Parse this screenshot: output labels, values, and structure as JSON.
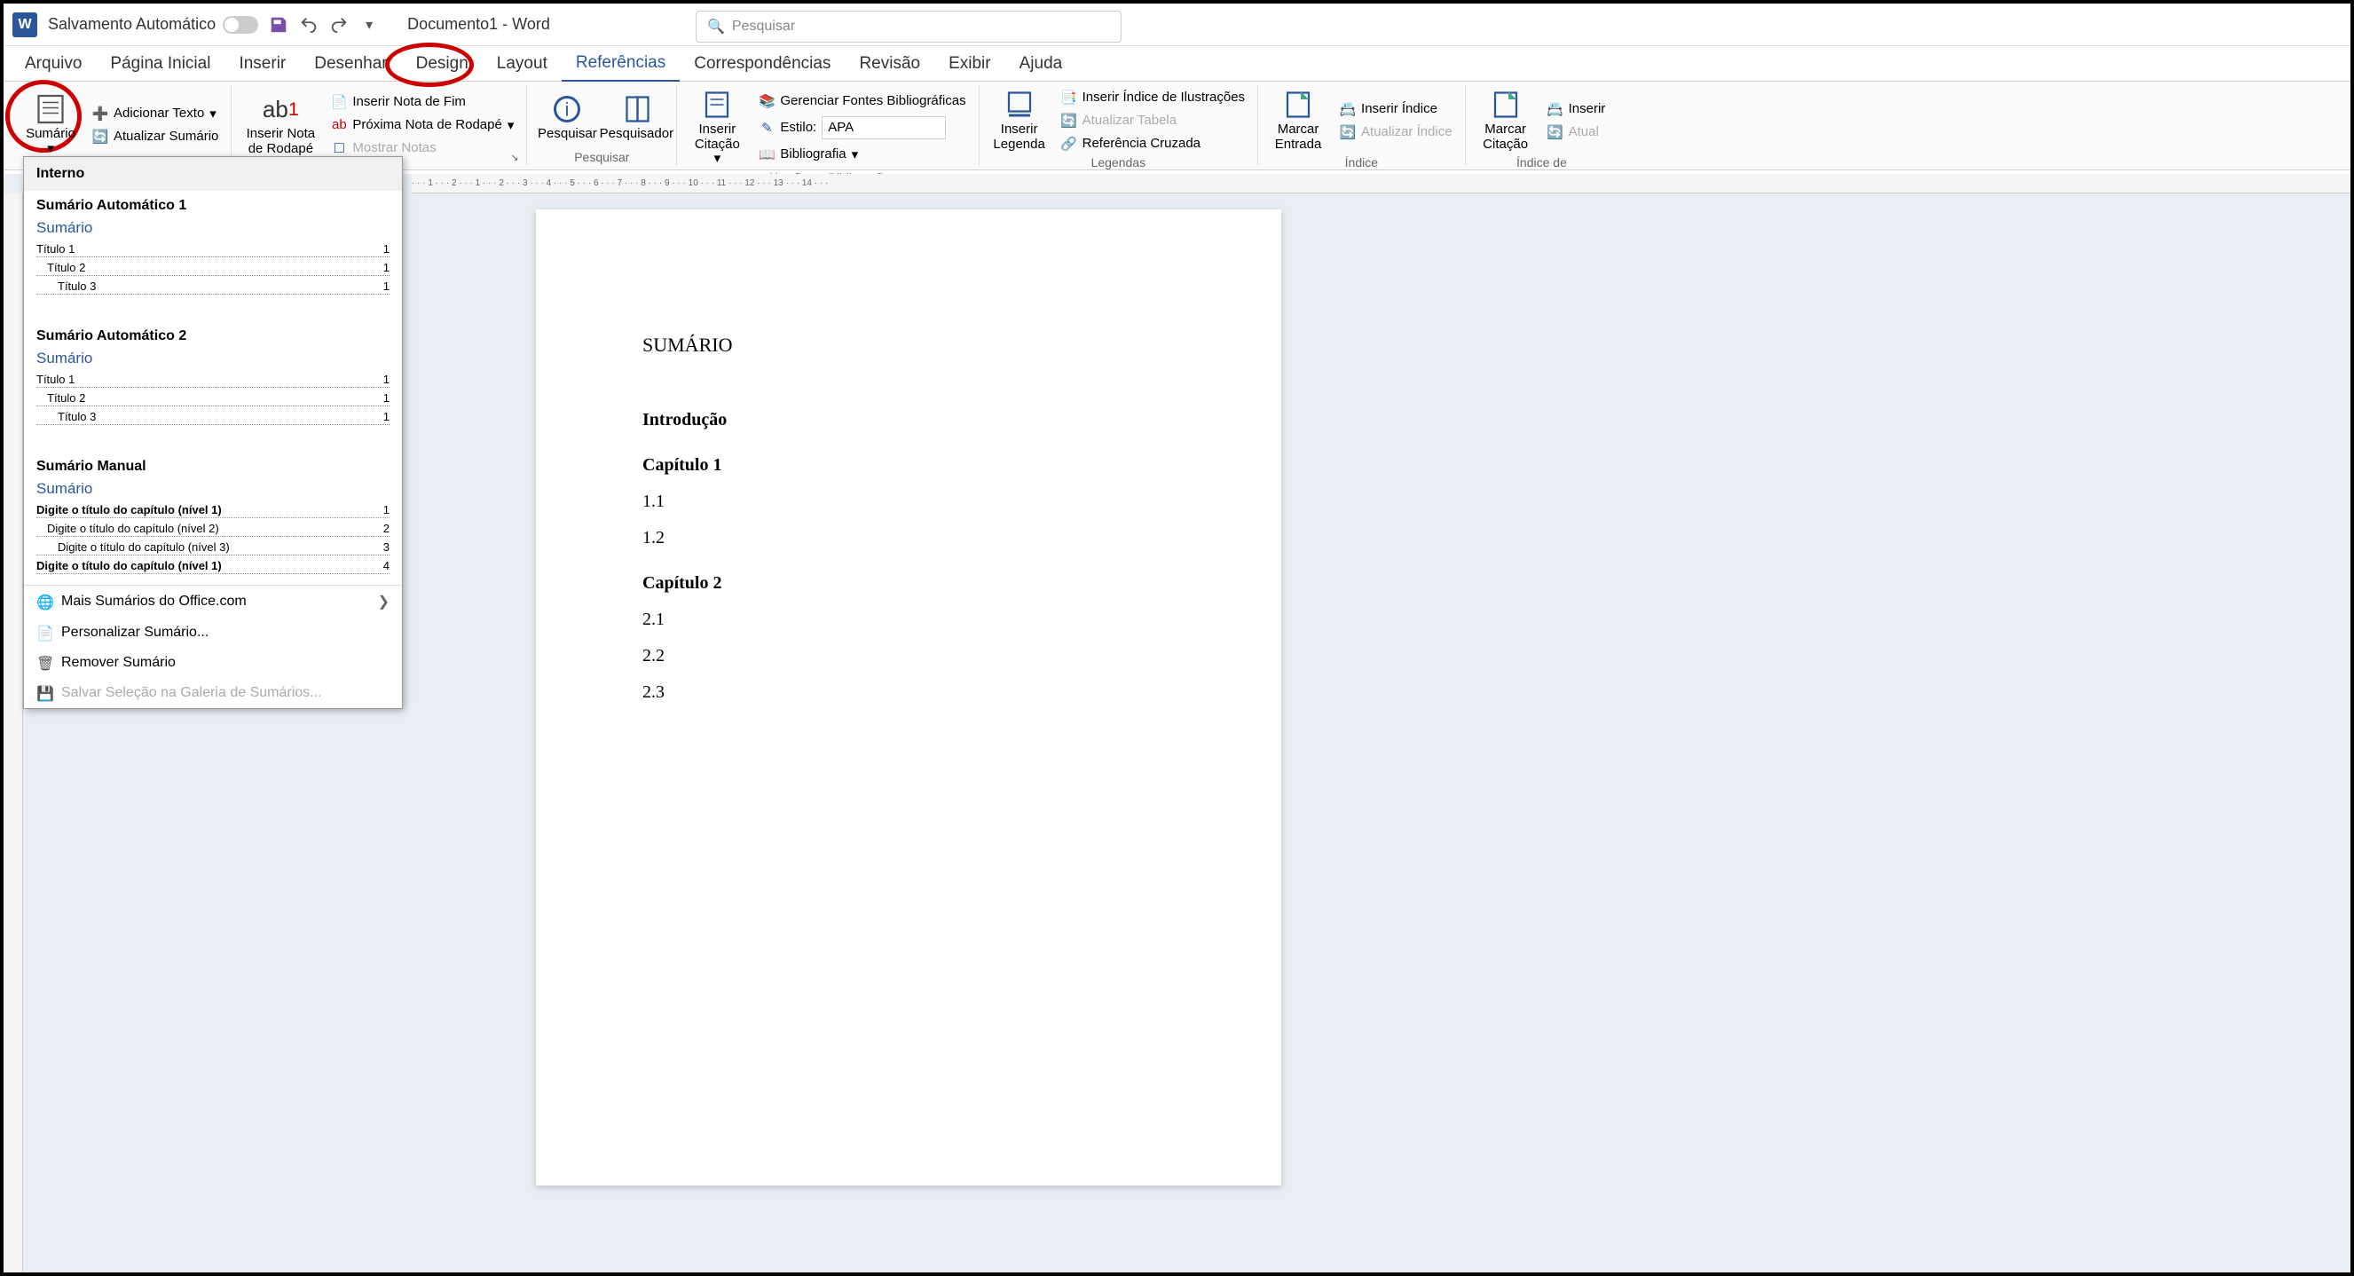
{
  "titlebar": {
    "autosave": "Salvamento Automático",
    "doc_title": "Documento1 - Word",
    "search_placeholder": "Pesquisar"
  },
  "tabs": {
    "arquivo": "Arquivo",
    "pagina_inicial": "Página Inicial",
    "inserir": "Inserir",
    "desenhar": "Desenhar",
    "design": "Design",
    "layout": "Layout",
    "referencias": "Referências",
    "correspondencias": "Correspondências",
    "revisao": "Revisão",
    "exibir": "Exibir",
    "ajuda": "Ajuda"
  },
  "ribbon": {
    "sumario": {
      "big": "Sumário",
      "add_text": "Adicionar Texto",
      "update": "Atualizar Sumário"
    },
    "notas": {
      "big": "Inserir Nota de Rodapé",
      "endnote": "Inserir Nota de Fim",
      "next": "Próxima Nota de Rodapé",
      "show": "Mostrar Notas"
    },
    "pesquisar": {
      "search": "Pesquisar",
      "researcher": "Pesquisador",
      "group": "Pesquisar"
    },
    "citacoes": {
      "big": "Inserir Citação",
      "manage": "Gerenciar Fontes Bibliográficas",
      "style_label": "Estilo:",
      "style_value": "APA",
      "bibliography": "Bibliografia",
      "group": "Citações e Bibliografia"
    },
    "legendas": {
      "big": "Inserir Legenda",
      "insert_idx": "Inserir Índice de Ilustrações",
      "update_table": "Atualizar Tabela",
      "cross_ref": "Referência Cruzada",
      "group": "Legendas"
    },
    "indice": {
      "big": "Marcar Entrada",
      "insert": "Inserir Índice",
      "update": "Atualizar Índice",
      "group": "Índice"
    },
    "indice_aut": {
      "big": "Marcar Citação",
      "insert": "Inserir",
      "update": "Atual",
      "group": "Índice de"
    }
  },
  "dropdown": {
    "interno": "Interno",
    "auto1": {
      "title": "Sumário Automático 1",
      "heading": "Sumário",
      "t1": "Título 1",
      "t2": "Título 2",
      "t3": "Título 3",
      "p": "1"
    },
    "auto2": {
      "title": "Sumário Automático 2",
      "heading": "Sumário",
      "t1": "Título 1",
      "t2": "Título 2",
      "t3": "Título 3",
      "p": "1"
    },
    "manual": {
      "title": "Sumário Manual",
      "heading": "Sumário",
      "l1": "Digite o título do capítulo (nível 1)",
      "p1": "1",
      "l2": "Digite o título do capítulo (nível 2)",
      "p2": "2",
      "l3": "Digite o título do capítulo (nível 3)",
      "p3": "3",
      "l4": "Digite o título do capítulo (nível 1)",
      "p4": "4"
    },
    "more": "Mais Sumários do Office.com",
    "custom": "Personalizar Sumário...",
    "remove": "Remover Sumário",
    "save": "Salvar Seleção na Galeria de Sumários..."
  },
  "document": {
    "sumario": "SUMÁRIO",
    "intro": "Introdução",
    "cap1": "Capítulo 1",
    "c11": "1.1",
    "c12": "1.2",
    "cap2": "Capítulo 2",
    "c21": "2.1",
    "c22": "2.2",
    "c23": "2.3"
  }
}
